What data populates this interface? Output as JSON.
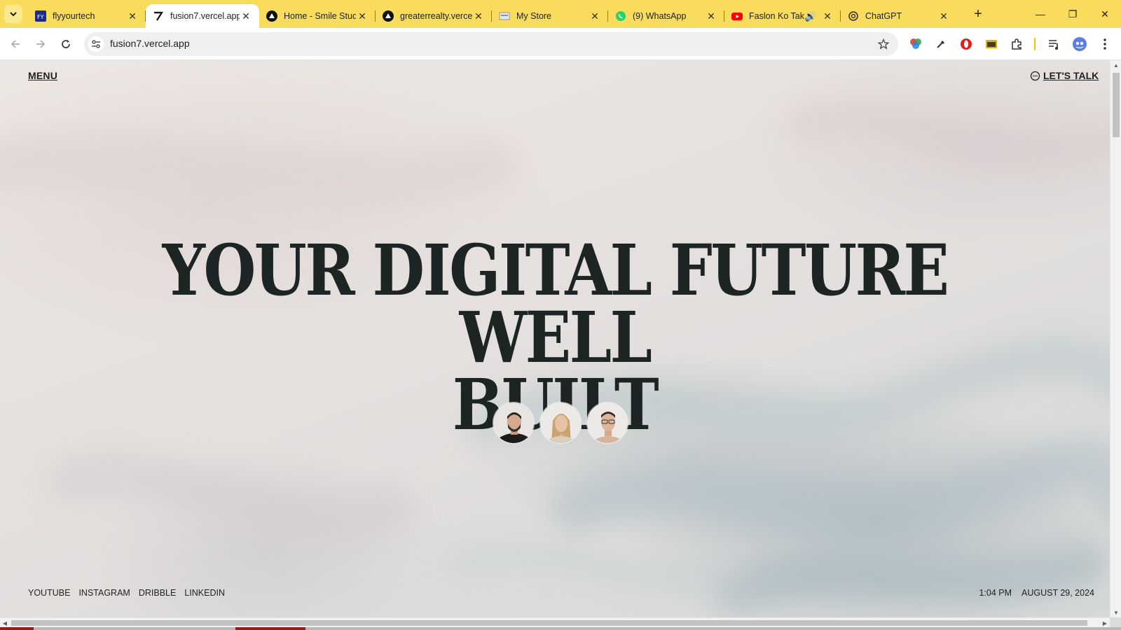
{
  "browser": {
    "tabs": [
      {
        "title": "flyyourtech",
        "icon": "flyyourtech-favicon",
        "active": false
      },
      {
        "title": "fusion7.vercel.app",
        "icon": "vercel-slash-favicon",
        "active": true
      },
      {
        "title": "Home - Smile Stud",
        "icon": "vercel-triangle-favicon",
        "active": false
      },
      {
        "title": "greaterrealty.verce",
        "icon": "vercel-triangle-favicon",
        "active": false
      },
      {
        "title": "My Store",
        "icon": "store-favicon",
        "active": false
      },
      {
        "title": "(9) WhatsApp",
        "icon": "whatsapp-favicon",
        "active": false
      },
      {
        "title": "Faslon Ko Tak",
        "icon": "youtube-favicon",
        "active": false,
        "audio": true
      },
      {
        "title": "ChatGPT",
        "icon": "chatgpt-favicon",
        "active": false
      }
    ],
    "address": {
      "url": "fusion7.vercel.app"
    },
    "colors": {
      "tabstrip": "#f9dc5c",
      "active_tab": "#ffffff"
    }
  },
  "page": {
    "menu_label": "MENU",
    "cta_label": "LET'S TALK",
    "hero_line1": "YOUR DIGITAL FUTURE WELL",
    "hero_line2": "BUILT",
    "team_avatars": [
      "team-member-1",
      "team-member-2",
      "team-member-3"
    ],
    "social_links": [
      "YOUTUBE",
      "INSTAGRAM",
      "DRIBBLE",
      "LINKEDIN"
    ],
    "time": "1:04 PM",
    "date": "AUGUST 29, 2024",
    "colors": {
      "text": "#1d2424"
    }
  }
}
